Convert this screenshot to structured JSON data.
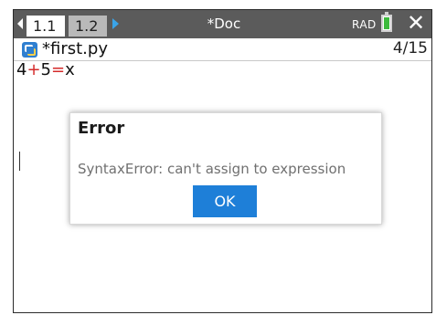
{
  "tabs": [
    {
      "label": "1.1"
    },
    {
      "label": "1.2"
    }
  ],
  "document": {
    "title": "*Doc",
    "angle_mode": "RAD"
  },
  "file": {
    "name": "*first.py",
    "line_position": "4/15"
  },
  "code": {
    "tokens": [
      "4",
      "+",
      "5",
      "=",
      "x"
    ]
  },
  "dialog": {
    "title": "Error",
    "message": "SyntaxError: can't assign to expression",
    "ok_label": "OK"
  },
  "colors": {
    "tabbar": "#5b5b5b",
    "accent": "#1e7fd8",
    "operator": "#d42a2a",
    "battery": "#3dbb3d"
  },
  "icons": {
    "left_arrow": "tab-scroll-left-icon",
    "right_arrow": "tab-scroll-right-icon",
    "battery": "battery-icon",
    "close": "close-icon",
    "file": "python-file-icon"
  }
}
